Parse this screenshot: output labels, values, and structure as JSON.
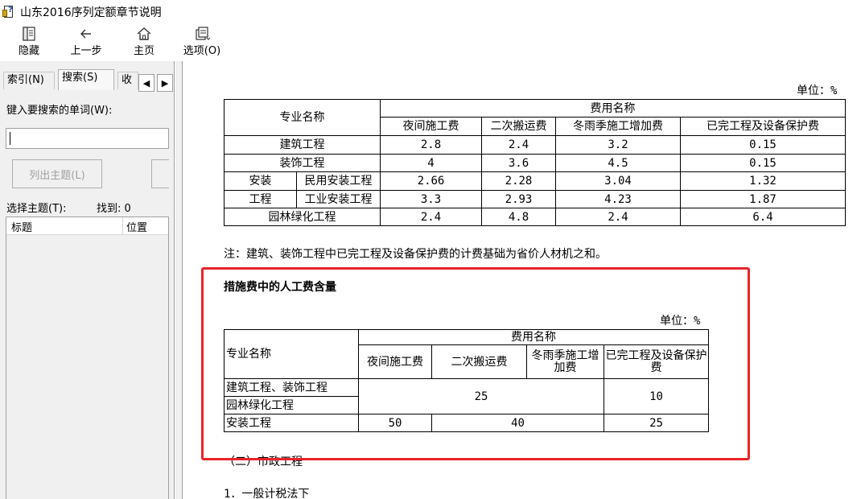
{
  "window": {
    "title": "山东2016序列定额章节说明"
  },
  "toolbar": {
    "hide_label": "隐藏",
    "back_label": "上一步",
    "home_label": "主页",
    "options_label": "选项(O)"
  },
  "sidebar": {
    "tabs": [
      "索引(N)",
      "搜索(S)",
      "收"
    ],
    "search_prompt": "键入要搜索的单词(W):",
    "search_value": "",
    "list_topics_label": "列出主题(L)",
    "select_topic_label": "选择主题(T):",
    "found_label": "找到: 0",
    "columns": [
      "标题",
      "位置"
    ]
  },
  "content": {
    "table1": {
      "unit": "单位：%",
      "header_major": "专业名称",
      "header_fees": "费用名称",
      "fee_columns": [
        "夜间施工费",
        "二次搬运费",
        "冬雨季施工增加费",
        "已完工程及设备保护费"
      ],
      "rows": [
        {
          "name": "建筑工程",
          "values": [
            "2.8",
            "2.4",
            "3.2",
            "0.15"
          ]
        },
        {
          "name": "装饰工程",
          "values": [
            "4",
            "3.6",
            "4.5",
            "0.15"
          ]
        }
      ],
      "install_group": [
        "安装",
        "工程"
      ],
      "install_rows": [
        {
          "name": "民用安装工程",
          "values": [
            "2.66",
            "2.28",
            "3.04",
            "1.32"
          ]
        },
        {
          "name": "工业安装工程",
          "values": [
            "3.3",
            "2.93",
            "4.23",
            "1.87"
          ]
        }
      ],
      "garden_row": {
        "name": "园林绿化工程",
        "values": [
          "2.4",
          "4.8",
          "2.4",
          "6.4"
        ]
      }
    },
    "note": "注：建筑、装饰工程中已完工程及设备保护费的计费基础为省价人材机之和。",
    "section_title": "措施费中的人工费含量",
    "table2": {
      "unit": "单位：%",
      "header_major": "专业名称",
      "header_fees": "费用名称",
      "fee_columns": [
        "夜间施工费",
        "二次搬运费",
        "冬雨季施工增加费",
        "已完工程及设备保护费"
      ],
      "row1_names": [
        "建筑工程、装饰工程",
        "园林绿化工程"
      ],
      "row1_values": [
        "25",
        "10"
      ],
      "row2_name": "安装工程",
      "row2_values": [
        "50",
        "40",
        "25"
      ]
    },
    "subsection": "（二）市政工程",
    "item1": "1．一般计税法下"
  },
  "colors": {
    "highlight_border": "#e8242a"
  }
}
